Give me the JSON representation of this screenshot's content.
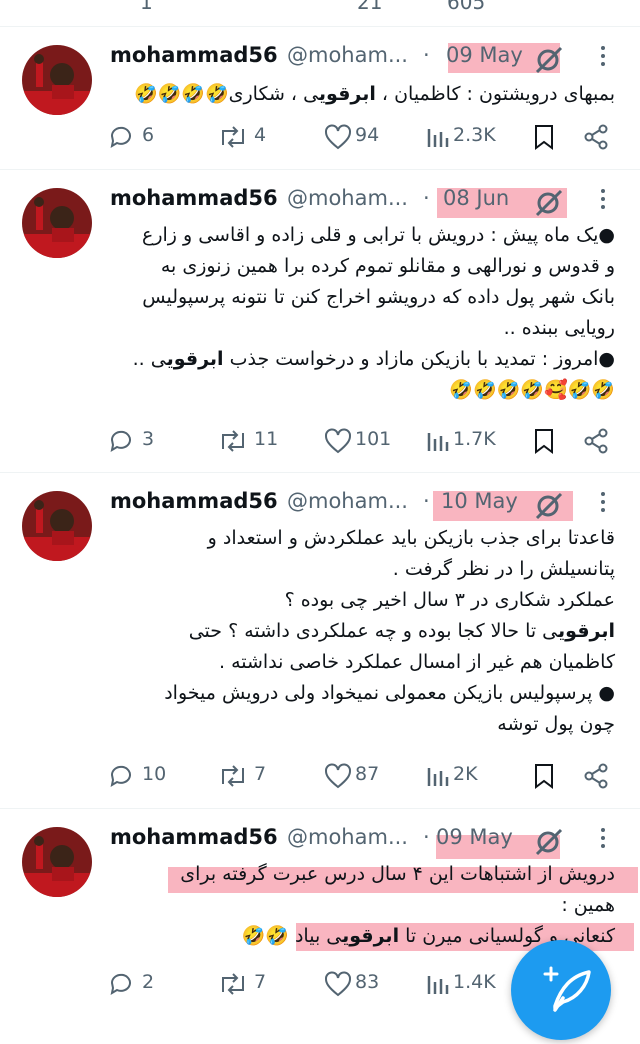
{
  "top_partial": {
    "reply_count": "1",
    "repost_count": "21",
    "like_count": "605"
  },
  "tweets": [
    {
      "name": "mohammad56",
      "handle": "@moham...",
      "separator": "·",
      "date": "09 May",
      "lines": [
        "بمبهای درویشتون : کاظمیان ، ",
        "ابرقوی",
        "ی ، شکاری",
        "🤣🤣🤣🤣"
      ],
      "replies": "6",
      "reposts": "4",
      "likes": "94",
      "views": "2.3K"
    },
    {
      "name": "mohammad56",
      "handle": "@moham...",
      "separator": "·",
      "date": "08 Jun",
      "lines": [
        "●یک ماه پیش : درویش با ترابی و قلی زاده و اقاسی و زارع",
        "و  قدوس و نورالهی و مقانلو تموم کرده برا همین زنوزی به",
        "بانک شهر پول داده که درویشو اخراج کنن تا نتونه پرسپولیس",
        "رویایی ببنده ..",
        "●امروز : تمدید با بازیکن مازاد و درخواست جذب ",
        "ابرقوی",
        "ی ..",
        "🤣🤣🥰🤣🤣🤣🤣"
      ],
      "replies": "3",
      "reposts": "11",
      "likes": "101",
      "views": "1.7K"
    },
    {
      "name": "mohammad56",
      "handle": "@moham...",
      "separator": "·",
      "date": "10 May",
      "lines": [
        "قاعدتا برای جذب بازیکن باید عملکردش و استعداد و",
        "پتانسیلش را در نظر گرفت .",
        "عملکرد شکاری در ۳ سال اخیر چی بوده ؟",
        "ابرقوی",
        "ی تا حالا کجا بوده و چه عملکردی داشته ؟ حتی",
        "کاظمیان هم غیر از امسال عملکرد خاصی نداشته .",
        "● پرسپولیس بازیکن معمولی نمیخواد ولی درویش میخواد",
        "چون پول توشه"
      ],
      "replies": "10",
      "reposts": "7",
      "likes": "87",
      "views": "2K"
    },
    {
      "name": "mohammad56",
      "handle": "@moham...",
      "separator": "·",
      "date": "09 May",
      "lines": [
        "درویش از اشتباهات این ۴ سال درس عبرت گرفته برای",
        "همین :",
        "کنعانی و گولسیانی میرن تا ",
        "ابرقوی",
        "ی بیاد",
        "🤣🤣"
      ],
      "replies": "2",
      "reposts": "7",
      "likes": "83",
      "views": "1.4K"
    }
  ],
  "colors": {
    "text": "#0f1419",
    "muted": "#536471",
    "divider": "#eff3f4",
    "accent": "#1d9bf0",
    "highlight": "#f4788c"
  },
  "icons": {
    "reply": "reply-icon",
    "repost": "repost-icon",
    "like": "like-icon",
    "views": "views-icon",
    "bookmark": "bookmark-icon",
    "share": "share-icon",
    "more": "more-icon",
    "compose": "compose-icon"
  }
}
